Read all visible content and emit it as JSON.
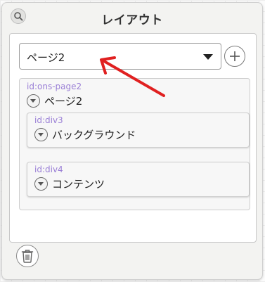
{
  "header": {
    "title": "レイアウト",
    "search_icon": "search-icon"
  },
  "page_select": {
    "value": "ページ2",
    "caret_icon": "caret-down-icon"
  },
  "add_button": {
    "icon": "plus-circle-icon"
  },
  "tree": {
    "root": {
      "id_label": "id:ons-page2",
      "label": "ページ2"
    },
    "children": [
      {
        "id_label": "id:div3",
        "label": "バックグラウンド"
      },
      {
        "id_label": "id:div4",
        "label": "コンテンツ"
      }
    ]
  },
  "delete_button": {
    "icon": "trash-icon"
  },
  "annotation": {
    "arrow_color": "#e02020"
  },
  "colors": {
    "id_text": "#9a7fd6"
  }
}
